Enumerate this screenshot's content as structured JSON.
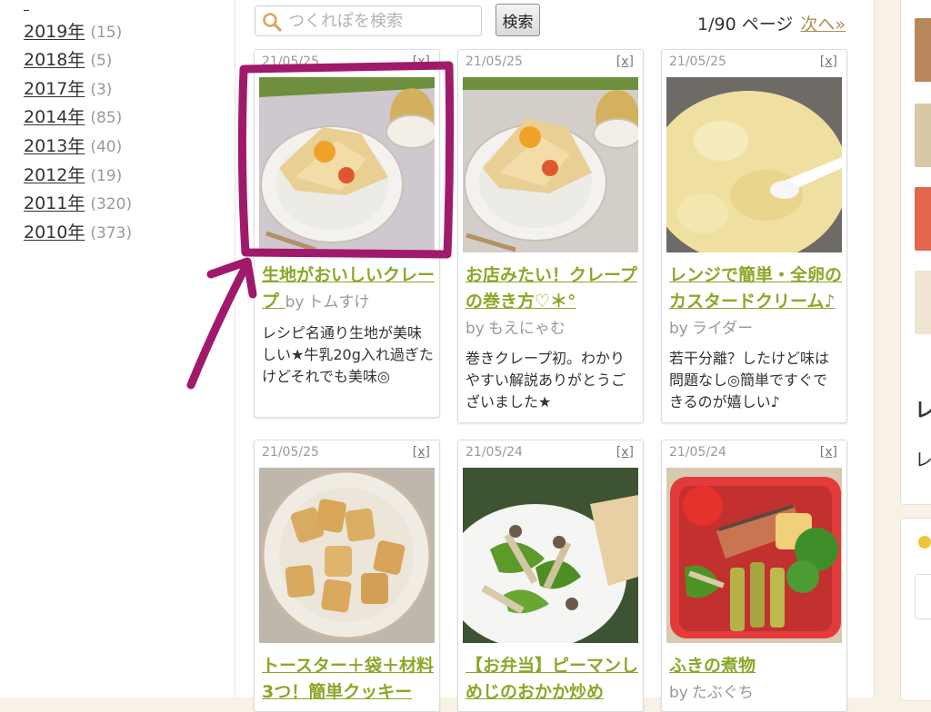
{
  "archive": {
    "years": [
      {
        "label": "2019年",
        "count": "(15)"
      },
      {
        "label": "2018年",
        "count": "(5)"
      },
      {
        "label": "2017年",
        "count": "(3)"
      },
      {
        "label": "2014年",
        "count": "(85)"
      },
      {
        "label": "2013年",
        "count": "(40)"
      },
      {
        "label": "2012年",
        "count": "(19)"
      },
      {
        "label": "2011年",
        "count": "(320)"
      },
      {
        "label": "2010年",
        "count": "(373)"
      }
    ]
  },
  "search": {
    "placeholder": "つくれぽを検索",
    "button_label": "検索",
    "icon": "search-icon"
  },
  "pagination": {
    "status": "1/90 ページ",
    "next_label": "次へ»"
  },
  "cards": [
    {
      "date": "21/05/25",
      "close": "[x]",
      "title": "生地がおいしいクレープ",
      "by": "by",
      "author": "トムすけ",
      "comment": "レシピ名通り生地が美味しい★牛乳20g入れ過ぎたけどそれでも美味◎"
    },
    {
      "date": "21/05/25",
      "close": "[x]",
      "title": "お店みたい！クレープの巻き方♡＊°",
      "by": "by",
      "author": "もえにゃむ",
      "comment": "巻きクレープ初。わかりやすい解説ありがとうございました★"
    },
    {
      "date": "21/05/25",
      "close": "[x]",
      "title": "レンジで簡単・全卵のカスタードクリーム♪",
      "by": "by",
      "author": "ライダー",
      "comment": "若干分離？したけど味は問題なし◎簡単ですぐできるのが嬉しい♪"
    },
    {
      "date": "21/05/25",
      "close": "[x]",
      "title": "トースター＋袋＋材料3つ！簡単クッキー",
      "by": "",
      "author": "",
      "comment": ""
    },
    {
      "date": "21/05/24",
      "close": "[x]",
      "title": "【お弁当】ピーマンしめじのおかか炒め",
      "by": "",
      "author": "",
      "comment": ""
    },
    {
      "date": "21/05/24",
      "close": "[x]",
      "title": "ふきの煮物",
      "by": "by",
      "author": "たぶぐち",
      "comment": ""
    }
  ],
  "right_sidebar": {
    "glyph_1": "レ",
    "glyph_2": "レ"
  },
  "annotation": {
    "color": "#a0196b",
    "shape": "hand-drawn box and arrow highlighting first recipe photo"
  }
}
